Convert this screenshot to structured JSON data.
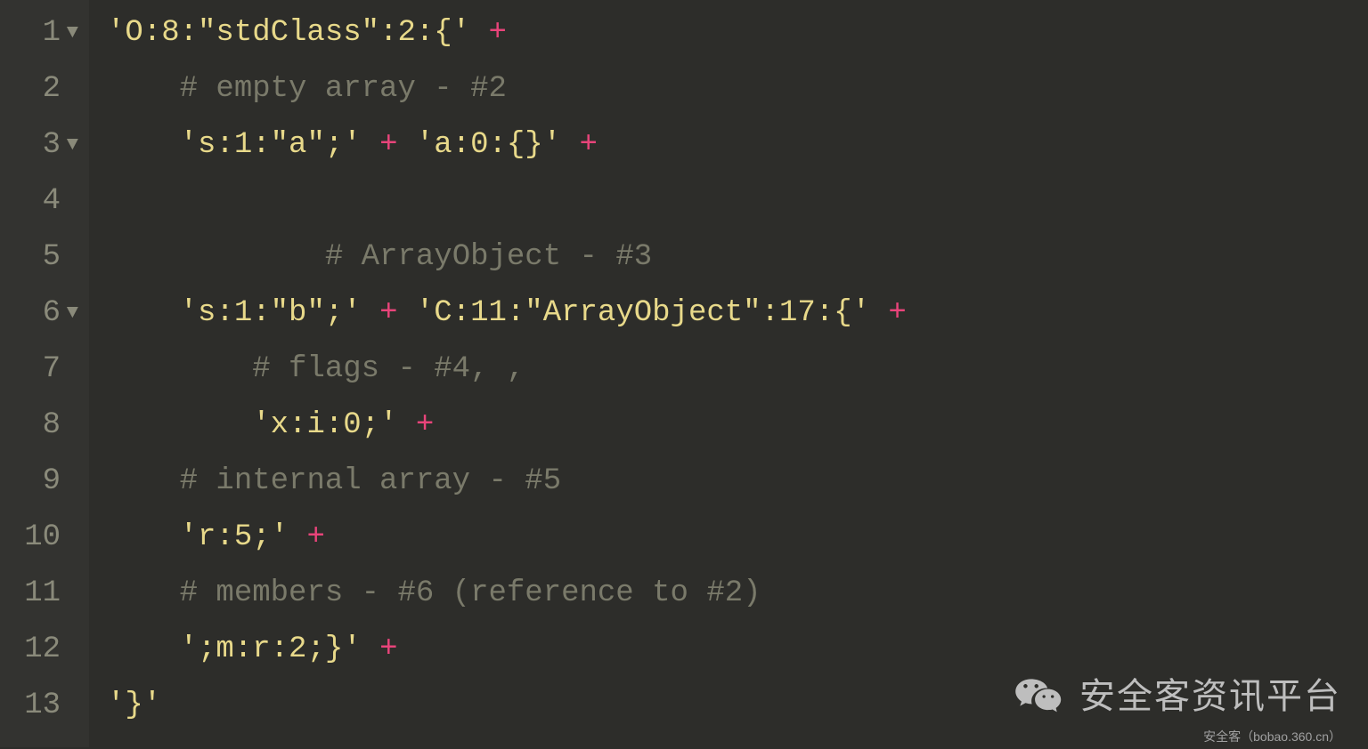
{
  "lines": [
    {
      "num": "1",
      "fold": true,
      "indent": 0,
      "tokens": [
        {
          "cls": "string",
          "t": "'O:8:\"stdClass\":2:{'"
        },
        {
          "cls": "",
          "t": " "
        },
        {
          "cls": "operator",
          "t": "+"
        }
      ]
    },
    {
      "num": "2",
      "fold": false,
      "indent": 1,
      "tokens": [
        {
          "cls": "comment",
          "t": "# empty array - #2"
        }
      ]
    },
    {
      "num": "3",
      "fold": true,
      "indent": 1,
      "tokens": [
        {
          "cls": "string",
          "t": "'s:1:\"a\";'"
        },
        {
          "cls": "",
          "t": " "
        },
        {
          "cls": "operator",
          "t": "+"
        },
        {
          "cls": "",
          "t": " "
        },
        {
          "cls": "string",
          "t": "'a:0:{}'"
        },
        {
          "cls": "",
          "t": " "
        },
        {
          "cls": "operator",
          "t": "+"
        }
      ]
    },
    {
      "num": "4",
      "fold": false,
      "indent": 1,
      "tokens": []
    },
    {
      "num": "5",
      "fold": false,
      "indent": 3,
      "tokens": [
        {
          "cls": "comment",
          "t": "# ArrayObject - #3"
        }
      ]
    },
    {
      "num": "6",
      "fold": true,
      "indent": 1,
      "tokens": [
        {
          "cls": "string",
          "t": "'s:1:\"b\";'"
        },
        {
          "cls": "",
          "t": " "
        },
        {
          "cls": "operator",
          "t": "+"
        },
        {
          "cls": "",
          "t": " "
        },
        {
          "cls": "string",
          "t": "'C:11:\"ArrayObject\":17:{'"
        },
        {
          "cls": "",
          "t": " "
        },
        {
          "cls": "operator",
          "t": "+"
        }
      ]
    },
    {
      "num": "7",
      "fold": false,
      "indent": 2,
      "tokens": [
        {
          "cls": "comment",
          "t": "# flags - #4, ,"
        }
      ]
    },
    {
      "num": "8",
      "fold": false,
      "indent": 2,
      "tokens": [
        {
          "cls": "string",
          "t": "'x:i:0;'"
        },
        {
          "cls": "",
          "t": " "
        },
        {
          "cls": "operator",
          "t": "+"
        }
      ]
    },
    {
      "num": "9",
      "fold": false,
      "indent": 1,
      "tokens": [
        {
          "cls": "comment",
          "t": "# internal array - #5"
        }
      ]
    },
    {
      "num": "10",
      "fold": false,
      "indent": 1,
      "tokens": [
        {
          "cls": "string",
          "t": "'r:5;'"
        },
        {
          "cls": "",
          "t": " "
        },
        {
          "cls": "operator",
          "t": "+"
        }
      ]
    },
    {
      "num": "11",
      "fold": false,
      "indent": 1,
      "tokens": [
        {
          "cls": "comment",
          "t": "# members - #6 (reference to #2)"
        }
      ]
    },
    {
      "num": "12",
      "fold": false,
      "indent": 1,
      "tokens": [
        {
          "cls": "string",
          "t": "';m:r:2;}'"
        },
        {
          "cls": "",
          "t": " "
        },
        {
          "cls": "operator",
          "t": "+"
        }
      ]
    },
    {
      "num": "13",
      "fold": false,
      "indent": 0,
      "tokens": [
        {
          "cls": "string",
          "t": "'}'"
        }
      ]
    }
  ],
  "watermark": {
    "text": "安全客资讯平台",
    "sub": "安全客（bobao.360.cn）"
  }
}
